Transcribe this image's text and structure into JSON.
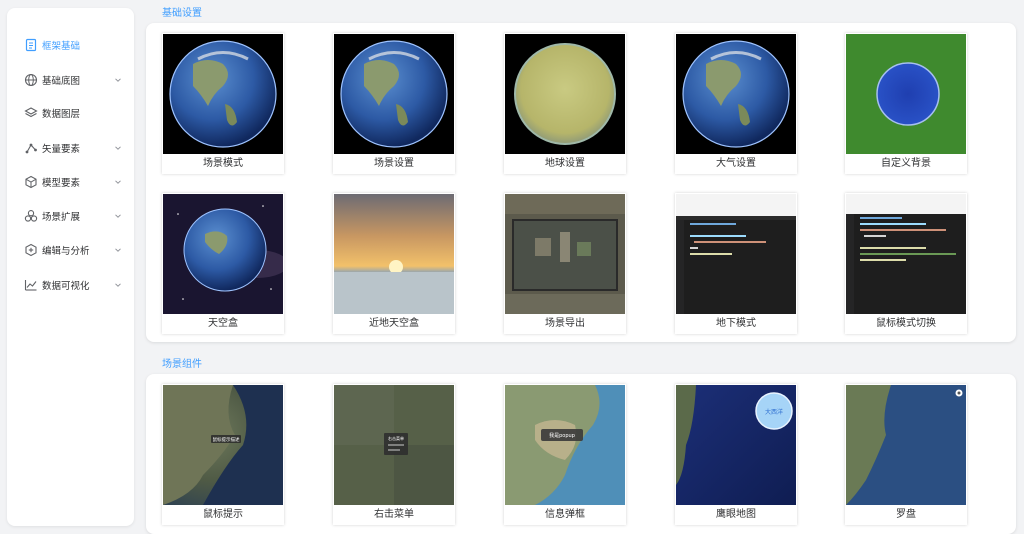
{
  "sidebar": {
    "items": [
      {
        "label": "框架基础",
        "icon": "document-icon",
        "active": true,
        "has_submenu": false
      },
      {
        "label": "基础底图",
        "icon": "globe-icon",
        "active": false,
        "has_submenu": true
      },
      {
        "label": "数据图层",
        "icon": "layers-icon",
        "active": false,
        "has_submenu": false
      },
      {
        "label": "矢量要素",
        "icon": "vector-icon",
        "active": false,
        "has_submenu": true
      },
      {
        "label": "模型要素",
        "icon": "cube-icon",
        "active": false,
        "has_submenu": true
      },
      {
        "label": "场景扩展",
        "icon": "scene-extend-icon",
        "active": false,
        "has_submenu": true
      },
      {
        "label": "编辑与分析",
        "icon": "edit-analysis-icon",
        "active": false,
        "has_submenu": true
      },
      {
        "label": "数据可视化",
        "icon": "chart-icon",
        "active": false,
        "has_submenu": true
      }
    ]
  },
  "sections": [
    {
      "title": "基础设置",
      "cards": [
        {
          "label": "场景模式",
          "thumb": "earth"
        },
        {
          "label": "场景设置",
          "thumb": "earth"
        },
        {
          "label": "地球设置",
          "thumb": "yellow-globe"
        },
        {
          "label": "大气设置",
          "thumb": "earth"
        },
        {
          "label": "自定义背景",
          "thumb": "green-bg-globe"
        },
        {
          "label": "天空盒",
          "thumb": "earth-space"
        },
        {
          "label": "近地天空盒",
          "thumb": "sunset-sky"
        },
        {
          "label": "场景导出",
          "thumb": "city-export"
        },
        {
          "label": "地下模式",
          "thumb": "code-editor"
        },
        {
          "label": "鼠标模式切换",
          "thumb": "code-editor-2"
        }
      ]
    },
    {
      "title": "场景组件",
      "cards": [
        {
          "label": "鼠标提示",
          "thumb": "satellite-coast",
          "tip": "鼠标提示描述"
        },
        {
          "label": "右击菜单",
          "thumb": "satellite-land",
          "tip": "右击菜单"
        },
        {
          "label": "信息弹框",
          "thumb": "satellite-america",
          "tip": "我是popup"
        },
        {
          "label": "鹰眼地图",
          "thumb": "ocean-overview",
          "tip": "大西洋"
        },
        {
          "label": "罗盘",
          "thumb": "satellite-coast-2"
        }
      ]
    }
  ],
  "colors": {
    "accent": "#409eff",
    "text": "#303133",
    "background": "#f2f3f5",
    "icon": "#606266"
  }
}
